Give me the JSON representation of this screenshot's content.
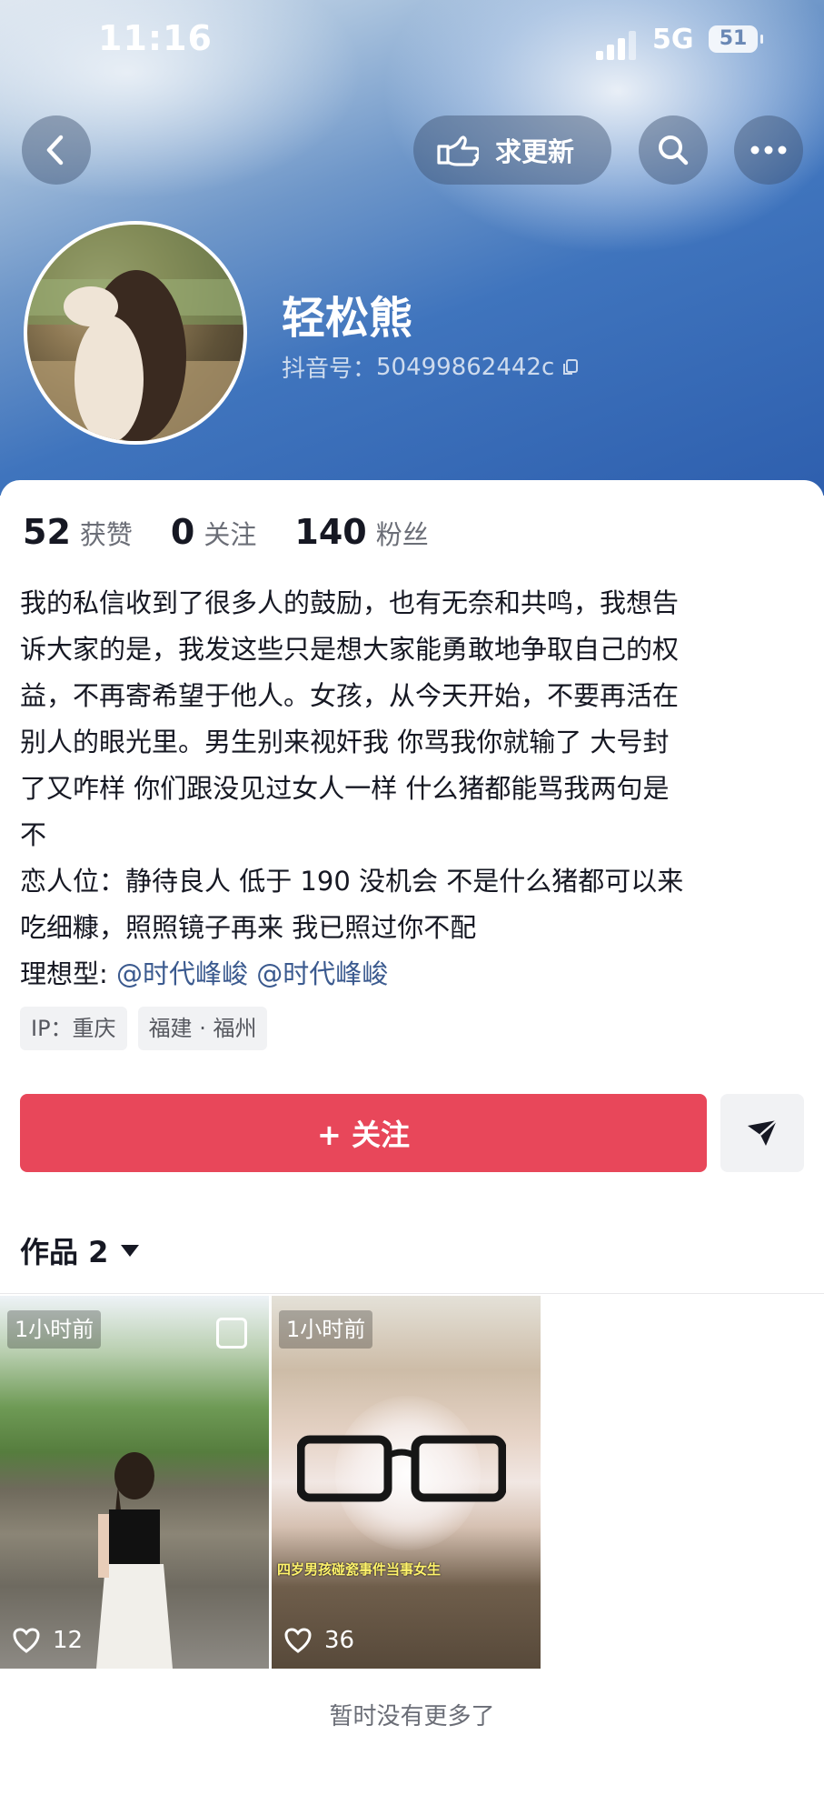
{
  "status_bar": {
    "time": "11:16",
    "network": "5G",
    "battery": "51"
  },
  "header": {
    "update_button_label": "求更新",
    "username": "轻松熊",
    "douyin_id_label": "抖音号：",
    "douyin_id": "50499862442c"
  },
  "stats": [
    {
      "value": "52",
      "label": "获赞"
    },
    {
      "value": "0",
      "label": "关注"
    },
    {
      "value": "140",
      "label": "粉丝"
    }
  ],
  "bio": {
    "lines": [
      "我的私信收到了很多人的鼓励，也有无奈和共鸣，我想告",
      "诉大家的是，我发这些只是想大家能勇敢地争取自己的权",
      "益，不再寄希望于他人。女孩，从今天开始，不要再活在",
      "别人的眼光里。男生别来视奸我 你骂我你就输了 大号封",
      "了又咋样 你们跟没见过女人一样 什么猪都能骂我两句是",
      "不",
      "恋人位：静待良人 低于 190 没机会 不是什么猪都可以来",
      "吃细糠，照照镜子再来 我已照过你不配"
    ],
    "ideal_label": "理想型: ",
    "mentions": [
      "@时代峰峻",
      "@时代峰峻"
    ]
  },
  "tags": [
    "IP：重庆",
    "福建 · 福州"
  ],
  "actions": {
    "follow_label": "+ 关注"
  },
  "works": {
    "tab_label": "作品 2",
    "items": [
      {
        "time": "1小时前",
        "likes": "12"
      },
      {
        "time": "1小时前",
        "likes": "36",
        "caption": "四岁男孩碰瓷事件当事女生"
      }
    ]
  },
  "footer_text": "暂时没有更多了"
}
